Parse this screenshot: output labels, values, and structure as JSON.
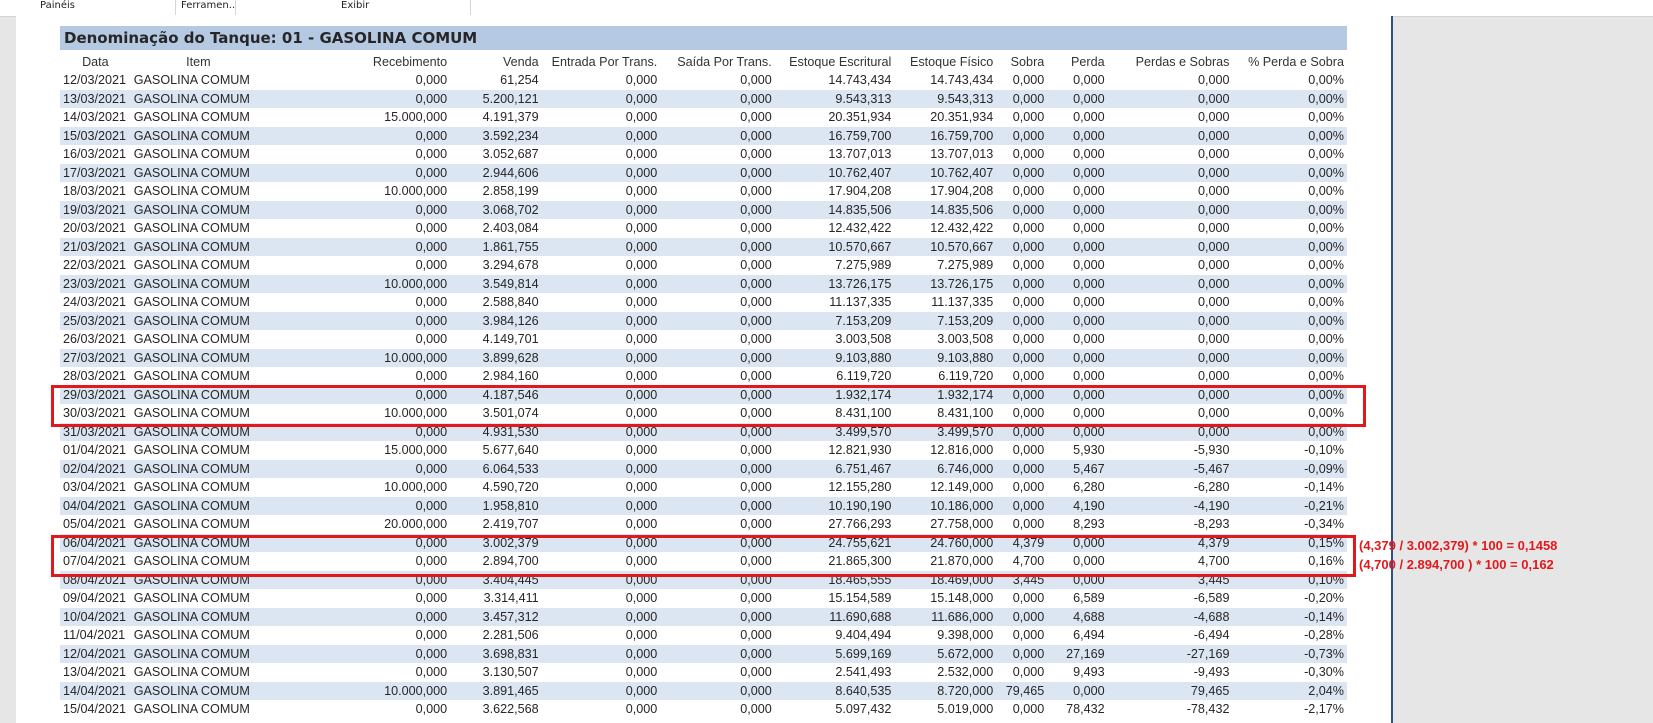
{
  "menu": [
    "Painéis",
    "Ferramen...",
    "Exibir"
  ],
  "report": {
    "title": "Denominação do Tanque: 01 - GASOLINA COMUM",
    "columns": [
      "Data",
      "Item",
      "Recebimento",
      "Venda",
      "Entrada Por Trans.",
      "Saída Por Trans.",
      "Estoque Escritural",
      "Estoque Físico",
      "Sobra",
      "Perda",
      "Perdas e Sobras",
      "% Perda e Sobra"
    ],
    "rows": [
      [
        "12/03/2021",
        "GASOLINA COMUM",
        "0,000",
        "61,254",
        "0,000",
        "0,000",
        "14.743,434",
        "14.743,434",
        "0,000",
        "0,000",
        "0,000",
        "0,00%"
      ],
      [
        "13/03/2021",
        "GASOLINA COMUM",
        "0,000",
        "5.200,121",
        "0,000",
        "0,000",
        "9.543,313",
        "9.543,313",
        "0,000",
        "0,000",
        "0,000",
        "0,00%"
      ],
      [
        "14/03/2021",
        "GASOLINA COMUM",
        "15.000,000",
        "4.191,379",
        "0,000",
        "0,000",
        "20.351,934",
        "20.351,934",
        "0,000",
        "0,000",
        "0,000",
        "0,00%"
      ],
      [
        "15/03/2021",
        "GASOLINA COMUM",
        "0,000",
        "3.592,234",
        "0,000",
        "0,000",
        "16.759,700",
        "16.759,700",
        "0,000",
        "0,000",
        "0,000",
        "0,00%"
      ],
      [
        "16/03/2021",
        "GASOLINA COMUM",
        "0,000",
        "3.052,687",
        "0,000",
        "0,000",
        "13.707,013",
        "13.707,013",
        "0,000",
        "0,000",
        "0,000",
        "0,00%"
      ],
      [
        "17/03/2021",
        "GASOLINA COMUM",
        "0,000",
        "2.944,606",
        "0,000",
        "0,000",
        "10.762,407",
        "10.762,407",
        "0,000",
        "0,000",
        "0,000",
        "0,00%"
      ],
      [
        "18/03/2021",
        "GASOLINA COMUM",
        "10.000,000",
        "2.858,199",
        "0,000",
        "0,000",
        "17.904,208",
        "17.904,208",
        "0,000",
        "0,000",
        "0,000",
        "0,00%"
      ],
      [
        "19/03/2021",
        "GASOLINA COMUM",
        "0,000",
        "3.068,702",
        "0,000",
        "0,000",
        "14.835,506",
        "14.835,506",
        "0,000",
        "0,000",
        "0,000",
        "0,00%"
      ],
      [
        "20/03/2021",
        "GASOLINA COMUM",
        "0,000",
        "2.403,084",
        "0,000",
        "0,000",
        "12.432,422",
        "12.432,422",
        "0,000",
        "0,000",
        "0,000",
        "0,00%"
      ],
      [
        "21/03/2021",
        "GASOLINA COMUM",
        "0,000",
        "1.861,755",
        "0,000",
        "0,000",
        "10.570,667",
        "10.570,667",
        "0,000",
        "0,000",
        "0,000",
        "0,00%"
      ],
      [
        "22/03/2021",
        "GASOLINA COMUM",
        "0,000",
        "3.294,678",
        "0,000",
        "0,000",
        "7.275,989",
        "7.275,989",
        "0,000",
        "0,000",
        "0,000",
        "0,00%"
      ],
      [
        "23/03/2021",
        "GASOLINA COMUM",
        "10.000,000",
        "3.549,814",
        "0,000",
        "0,000",
        "13.726,175",
        "13.726,175",
        "0,000",
        "0,000",
        "0,000",
        "0,00%"
      ],
      [
        "24/03/2021",
        "GASOLINA COMUM",
        "0,000",
        "2.588,840",
        "0,000",
        "0,000",
        "11.137,335",
        "11.137,335",
        "0,000",
        "0,000",
        "0,000",
        "0,00%"
      ],
      [
        "25/03/2021",
        "GASOLINA COMUM",
        "0,000",
        "3.984,126",
        "0,000",
        "0,000",
        "7.153,209",
        "7.153,209",
        "0,000",
        "0,000",
        "0,000",
        "0,00%"
      ],
      [
        "26/03/2021",
        "GASOLINA COMUM",
        "0,000",
        "4.149,701",
        "0,000",
        "0,000",
        "3.003,508",
        "3.003,508",
        "0,000",
        "0,000",
        "0,000",
        "0,00%"
      ],
      [
        "27/03/2021",
        "GASOLINA COMUM",
        "10.000,000",
        "3.899,628",
        "0,000",
        "0,000",
        "9.103,880",
        "9.103,880",
        "0,000",
        "0,000",
        "0,000",
        "0,00%"
      ],
      [
        "28/03/2021",
        "GASOLINA COMUM",
        "0,000",
        "2.984,160",
        "0,000",
        "0,000",
        "6.119,720",
        "6.119,720",
        "0,000",
        "0,000",
        "0,000",
        "0,00%"
      ],
      [
        "29/03/2021",
        "GASOLINA COMUM",
        "0,000",
        "4.187,546",
        "0,000",
        "0,000",
        "1.932,174",
        "1.932,174",
        "0,000",
        "0,000",
        "0,000",
        "0,00%"
      ],
      [
        "30/03/2021",
        "GASOLINA COMUM",
        "10.000,000",
        "3.501,074",
        "0,000",
        "0,000",
        "8.431,100",
        "8.431,100",
        "0,000",
        "0,000",
        "0,000",
        "0,00%"
      ],
      [
        "31/03/2021",
        "GASOLINA COMUM",
        "0,000",
        "4.931,530",
        "0,000",
        "0,000",
        "3.499,570",
        "3.499,570",
        "0,000",
        "0,000",
        "0,000",
        "0,00%"
      ],
      [
        "01/04/2021",
        "GASOLINA COMUM",
        "15.000,000",
        "5.677,640",
        "0,000",
        "0,000",
        "12.821,930",
        "12.816,000",
        "0,000",
        "5,930",
        "-5,930",
        "-0,10%"
      ],
      [
        "02/04/2021",
        "GASOLINA COMUM",
        "0,000",
        "6.064,533",
        "0,000",
        "0,000",
        "6.751,467",
        "6.746,000",
        "0,000",
        "5,467",
        "-5,467",
        "-0,09%"
      ],
      [
        "03/04/2021",
        "GASOLINA COMUM",
        "10.000,000",
        "4.590,720",
        "0,000",
        "0,000",
        "12.155,280",
        "12.149,000",
        "0,000",
        "6,280",
        "-6,280",
        "-0,14%"
      ],
      [
        "04/04/2021",
        "GASOLINA COMUM",
        "0,000",
        "1.958,810",
        "0,000",
        "0,000",
        "10.190,190",
        "10.186,000",
        "0,000",
        "4,190",
        "-4,190",
        "-0,21%"
      ],
      [
        "05/04/2021",
        "GASOLINA COMUM",
        "20.000,000",
        "2.419,707",
        "0,000",
        "0,000",
        "27.766,293",
        "27.758,000",
        "0,000",
        "8,293",
        "-8,293",
        "-0,34%"
      ],
      [
        "06/04/2021",
        "GASOLINA COMUM",
        "0,000",
        "3.002,379",
        "0,000",
        "0,000",
        "24.755,621",
        "24.760,000",
        "4,379",
        "0,000",
        "4,379",
        "0,15%"
      ],
      [
        "07/04/2021",
        "GASOLINA COMUM",
        "0,000",
        "2.894,700",
        "0,000",
        "0,000",
        "21.865,300",
        "21.870,000",
        "4,700",
        "0,000",
        "4,700",
        "0,16%"
      ],
      [
        "08/04/2021",
        "GASOLINA COMUM",
        "0,000",
        "3.404,445",
        "0,000",
        "0,000",
        "18.465,555",
        "18.469,000",
        "3,445",
        "0,000",
        "3,445",
        "0,10%"
      ],
      [
        "09/04/2021",
        "GASOLINA COMUM",
        "0,000",
        "3.314,411",
        "0,000",
        "0,000",
        "15.154,589",
        "15.148,000",
        "0,000",
        "6,589",
        "-6,589",
        "-0,20%"
      ],
      [
        "10/04/2021",
        "GASOLINA COMUM",
        "0,000",
        "3.457,312",
        "0,000",
        "0,000",
        "11.690,688",
        "11.686,000",
        "0,000",
        "4,688",
        "-4,688",
        "-0,14%"
      ],
      [
        "11/04/2021",
        "GASOLINA COMUM",
        "0,000",
        "2.281,506",
        "0,000",
        "0,000",
        "9.404,494",
        "9.398,000",
        "0,000",
        "6,494",
        "-6,494",
        "-0,28%"
      ],
      [
        "12/04/2021",
        "GASOLINA COMUM",
        "0,000",
        "3.698,831",
        "0,000",
        "0,000",
        "5.699,169",
        "5.672,000",
        "0,000",
        "27,169",
        "-27,169",
        "-0,73%"
      ],
      [
        "13/04/2021",
        "GASOLINA COMUM",
        "0,000",
        "3.130,507",
        "0,000",
        "0,000",
        "2.541,493",
        "2.532,000",
        "0,000",
        "9,493",
        "-9,493",
        "-0,30%"
      ],
      [
        "14/04/2021",
        "GASOLINA COMUM",
        "10.000,000",
        "3.891,465",
        "0,000",
        "0,000",
        "8.640,535",
        "8.720,000",
        "79,465",
        "0,000",
        "79,465",
        "2,04%"
      ],
      [
        "15/04/2021",
        "GASOLINA COMUM",
        "0,000",
        "3.622,568",
        "0,000",
        "0,000",
        "5.097,432",
        "5.019,000",
        "0,000",
        "78,432",
        "-78,432",
        "-2,17%"
      ]
    ]
  },
  "annotations": [
    "(4,379 / 3.002,379) * 100 = 0,1458",
    "(4,700 / 2.894,700 ) * 100 = 0,162"
  ],
  "colors": {
    "header_band": "#b6c9e2",
    "stripe": "#dce6f2",
    "highlight": "#e2191c",
    "page_border": "#2f4f8a"
  }
}
